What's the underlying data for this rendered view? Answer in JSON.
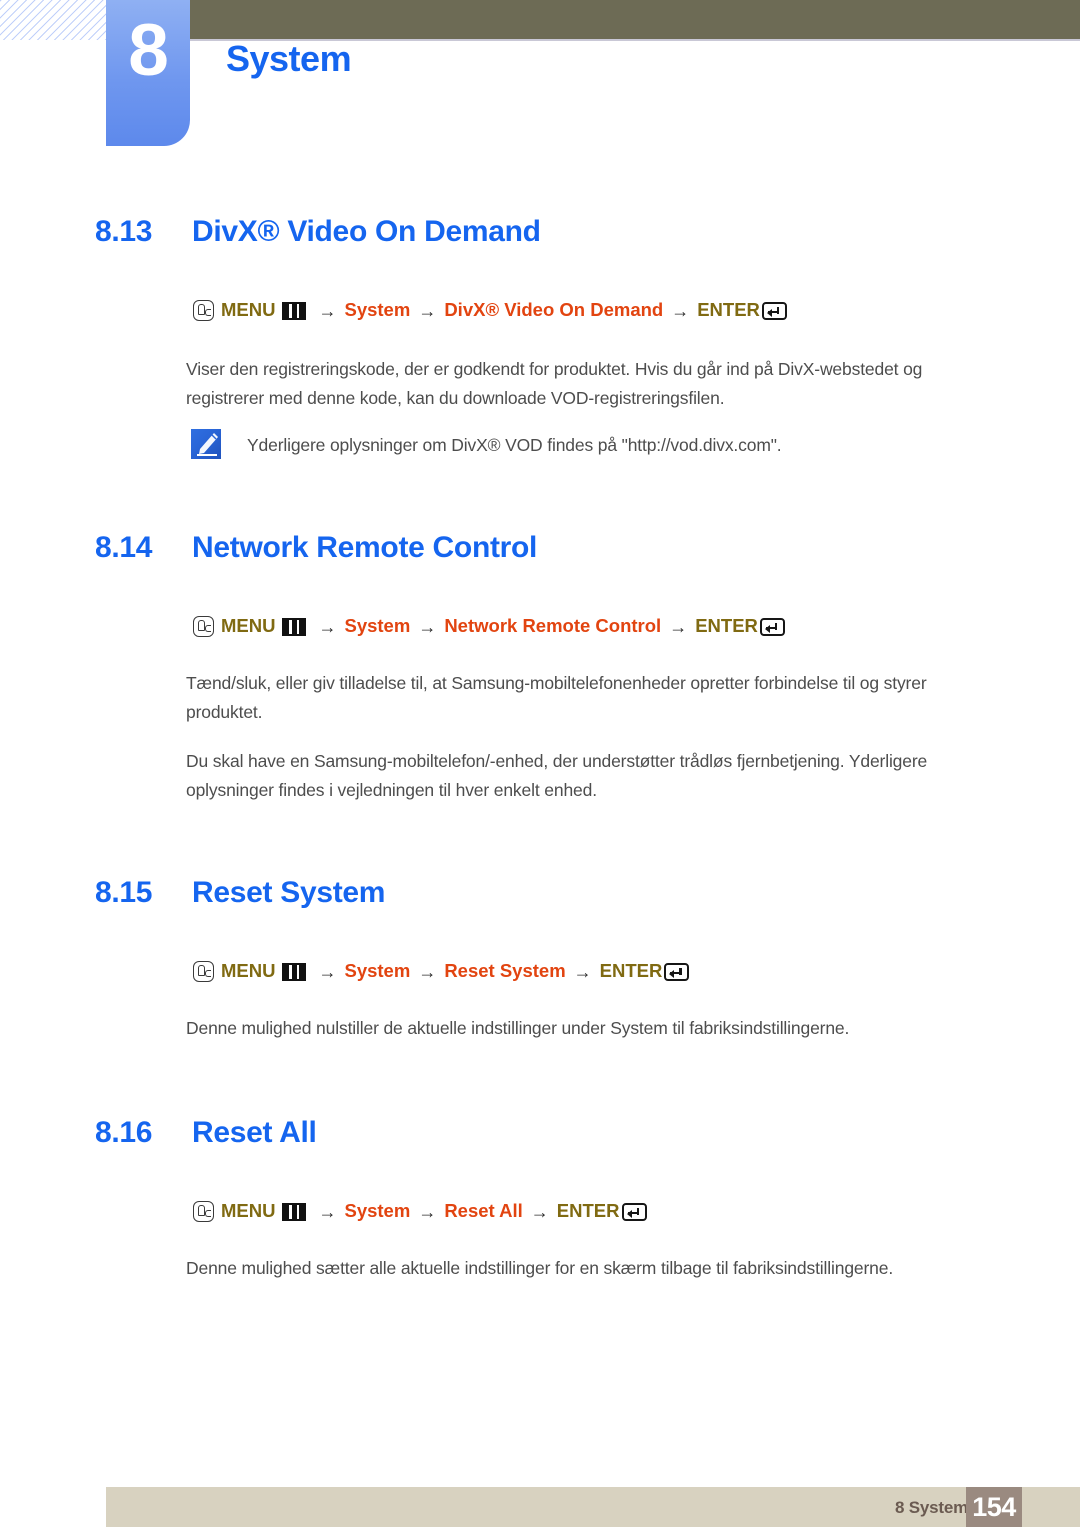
{
  "chapter": {
    "number": "8",
    "title": "System"
  },
  "icons": {
    "hand": "hand-press-icon",
    "menu_bars": "menu-bars-icon",
    "enter_key": "enter-key-icon",
    "note": "note-pen-icon"
  },
  "colors": {
    "heading_blue": "#1565ef",
    "path_orange": "#e24410",
    "path_gold": "#806a12",
    "header_olive": "#6d6b55",
    "footer_beige": "#d8d2c0",
    "footer_page_box": "#9a8a80",
    "body_gray": "#4d4d4d"
  },
  "sections": [
    {
      "number": "8.13",
      "name": "DivX® Video On Demand",
      "path": {
        "menu_label": "MENU",
        "arrow": "→",
        "items": [
          "System",
          "DivX® Video On Demand"
        ],
        "enter_label": "ENTER"
      },
      "paragraphs": [
        "Viser den registreringskode, der er godkendt for produktet. Hvis du går ind på DivX-webstedet og registrerer med denne kode, kan du downloade VOD-registreringsfilen."
      ],
      "note": "Yderligere oplysninger om DivX® VOD findes på \"http://vod.divx.com\"."
    },
    {
      "number": "8.14",
      "name": "Network Remote Control",
      "path": {
        "menu_label": "MENU",
        "arrow": "→",
        "items": [
          "System",
          "Network Remote Control"
        ],
        "enter_label": "ENTER"
      },
      "paragraphs": [
        "Tænd/sluk, eller giv tilladelse til, at Samsung-mobiltelefonenheder opretter forbindelse til og styrer produktet.",
        "Du skal have en Samsung-mobiltelefon/-enhed, der understøtter trådløs fjernbetjening. Yderligere oplysninger findes i vejledningen til hver enkelt enhed."
      ],
      "note": null
    },
    {
      "number": "8.15",
      "name": "Reset System",
      "path": {
        "menu_label": "MENU",
        "arrow": "→",
        "items": [
          "System",
          "Reset System"
        ],
        "enter_label": "ENTER"
      },
      "paragraphs": [
        "Denne mulighed nulstiller de aktuelle indstillinger under System til fabriksindstillingerne."
      ],
      "note": null
    },
    {
      "number": "8.16",
      "name": "Reset All",
      "path": {
        "menu_label": "MENU",
        "arrow": "→",
        "items": [
          "System",
          "Reset All"
        ],
        "enter_label": "ENTER"
      },
      "paragraphs": [
        "Denne mulighed sætter alle aktuelle indstillinger for en skærm tilbage til fabriksindstillingerne."
      ],
      "note": null
    }
  ],
  "footer": {
    "label": "8 System",
    "page": "154"
  }
}
